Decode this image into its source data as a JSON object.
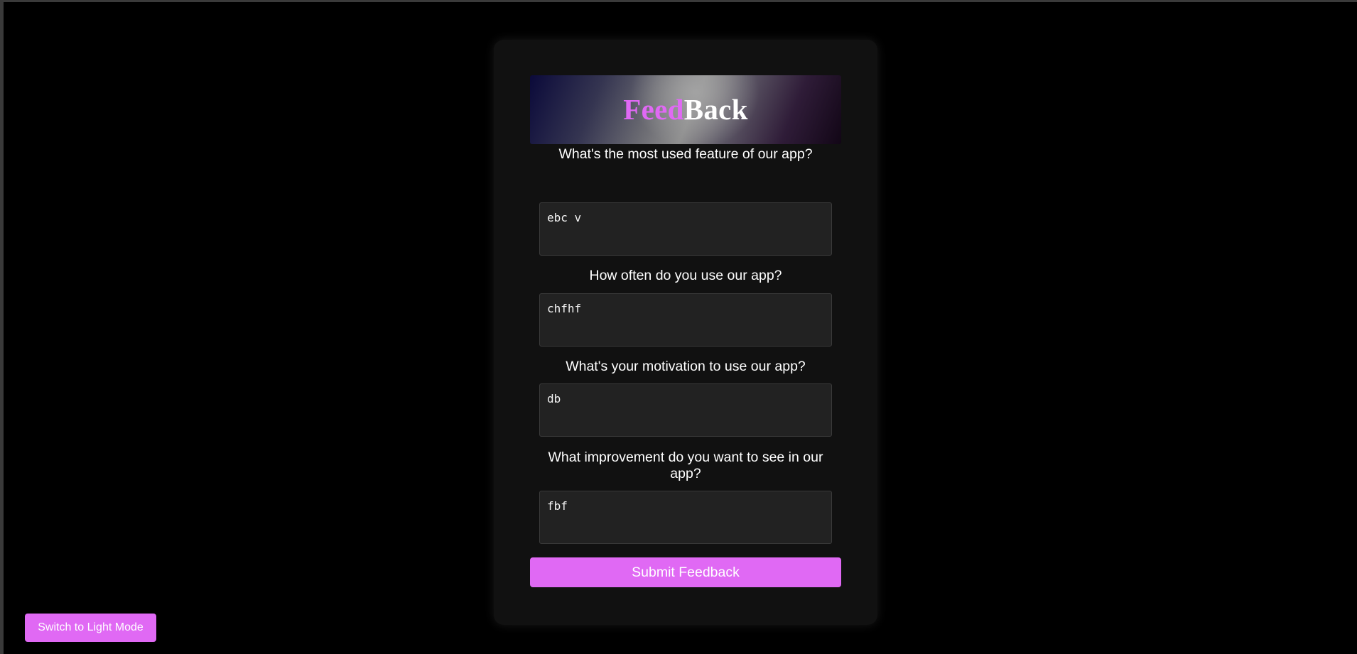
{
  "header": {
    "title_part1": "Feed",
    "title_part2": "Back"
  },
  "questions": [
    {
      "label": "What's the most used feature of our app?",
      "value": "ebc v"
    },
    {
      "label": "How often do you use our app?",
      "value": "chfhf"
    },
    {
      "label": "What's your motivation to use our app?",
      "value": "db"
    },
    {
      "label": "What improvement do you want to see in our app?",
      "value": "fbf"
    }
  ],
  "form": {
    "submit_label": "Submit Feedback"
  },
  "theme_toggle": {
    "label": "Switch to Light Mode"
  },
  "colors": {
    "accent": "#e069f4",
    "page_background": "#000000",
    "card_background": "#111111",
    "input_background": "#222222",
    "text": "#ffffff"
  }
}
